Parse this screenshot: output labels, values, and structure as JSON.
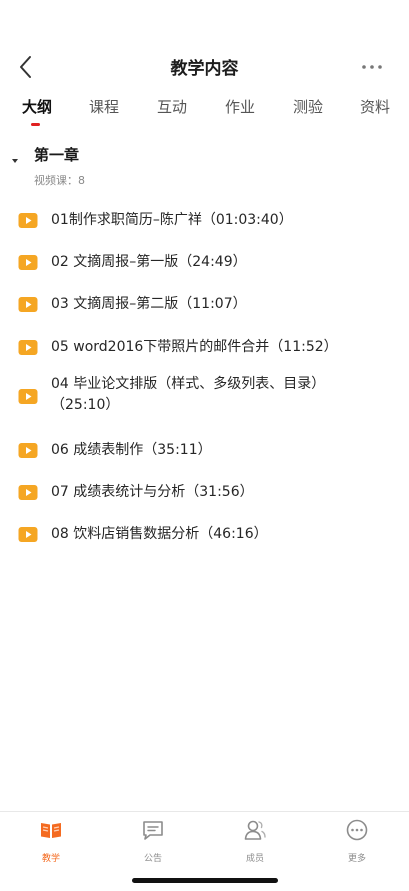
{
  "header": {
    "title": "教学内容",
    "back_icon": "chevron-left-icon",
    "more_icon": "more-dots-icon"
  },
  "tabs": [
    {
      "label": "大纲",
      "active": true
    },
    {
      "label": "课程",
      "active": false
    },
    {
      "label": "互动",
      "active": false
    },
    {
      "label": "作业",
      "active": false
    },
    {
      "label": "测验",
      "active": false
    },
    {
      "label": "资料",
      "active": false
    }
  ],
  "chapter": {
    "title": "第一章",
    "video_count": "视频课：8",
    "expanded": true
  },
  "lessons": [
    {
      "title": "01制作求职简历–陈广祥（01:03:40）"
    },
    {
      "title": "02 文摘周报–第一版（24:49）"
    },
    {
      "title": "03 文摘周报–第二版（11:07）"
    },
    {
      "title": "05 word2016下带照片的邮件合并（11:52）"
    },
    {
      "title": "04 毕业论文排版（样式、多级列表、目录）（25:10）"
    },
    {
      "title": "06 成绩表制作（35:11）"
    },
    {
      "title": "07 成绩表统计与分析（31:56）"
    },
    {
      "title": "08 饮料店销售数据分析（46:16）"
    }
  ],
  "bottom_nav": [
    {
      "label": "教学",
      "icon": "book-icon",
      "active": true
    },
    {
      "label": "公告",
      "icon": "message-icon",
      "active": false
    },
    {
      "label": "成员",
      "icon": "members-icon",
      "active": false
    },
    {
      "label": "更多",
      "icon": "more-circle-icon",
      "active": false
    }
  ],
  "colors": {
    "accent": "#f46b21",
    "tab_indicator": "#e02020",
    "lesson_icon": "#f5a623"
  }
}
